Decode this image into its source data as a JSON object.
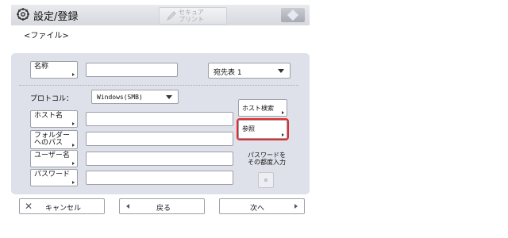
{
  "header": {
    "title": "設定/登録",
    "center_button": "セキュア\nプリント"
  },
  "subtitle": "<ファイル>",
  "form": {
    "name_label": "名称",
    "address_book_value": "宛先表 1",
    "protocol_label": "プロトコル：",
    "protocol_value": "Windows(SMB)",
    "host_search_label": "ホスト検索",
    "host_name_label": "ホスト名",
    "browse_label": "参照",
    "folder_path_label": "フォルダー\nへのパス",
    "user_name_label": "ユーザー名",
    "password_label": "パスワード",
    "password_note": "パスワードを\nその都度入力"
  },
  "footer": {
    "cancel_label": "キャンセル",
    "back_label": "戻る",
    "next_label": "次へ"
  },
  "colors": {
    "panel": "#dfe1ea",
    "highlight": "#e22b2b"
  },
  "icons": {
    "header": "gear-icon",
    "secure_print": "pen-icon",
    "cancel": "close-icon"
  }
}
